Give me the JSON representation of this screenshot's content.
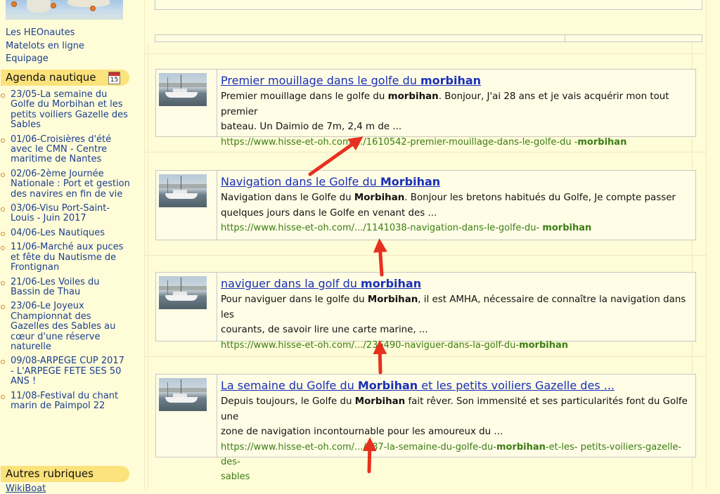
{
  "sidebar": {
    "links": [
      "Les HEOnautes",
      "Matelots en ligne",
      "Equipage"
    ],
    "agenda_title": "Agenda nautique",
    "calendar_day": "15",
    "agenda_items": [
      "23/05-La semaine du Golfe du Morbihan et les petits voiliers Gazelle des Sables",
      "01/06-Croisières d'été avec le CMN - Centre maritime de Nantes",
      "02/06-2ème Journée Nationale : Port et gestion des navires en fin de vie",
      "03/06-Visu Port-Saint-Louis - Juin 2017",
      "04/06-Les Nautiques",
      "11/06-Marché aux puces et fête du Nautisme de Frontignan",
      "21/06-Les Voiles du Bassin de Thau",
      "23/06-Le Joyeux Championnat des Gazelles des Sables au cœur d'une réserve naturelle",
      "09/08-ARPEGE CUP 2017 - L'ARPEGE FETE SES 50 ANS !",
      "11/08-Festival du chant marin de Paimpol 22"
    ],
    "autres_title": "Autres rubriques",
    "autres_first": "WikiBoat"
  },
  "results": [
    {
      "title_pre": "Premier mouillage dans le golfe du ",
      "title_bold": "morbihan",
      "title_post": "",
      "snippet_lines": [
        [
          {
            "t": "Premier mouillage dans le golfe du "
          },
          {
            "t": "morbihan",
            "b": true
          },
          {
            "t": ". Bonjour, J'ai 28 ans et je vais acquérir mon tout premier"
          }
        ],
        [
          {
            "t": "bateau. Un Daimio de 7m, 2,4 m de ..."
          }
        ]
      ],
      "url_lines": [
        [
          {
            "t": "https://www.hisse-et-oh.com/.../1610542-premier-mouillage-dans-le-golfe-du -"
          },
          {
            "t": "morbihan",
            "b": true
          }
        ]
      ]
    },
    {
      "title_pre": "Navigation dans le Golfe du ",
      "title_bold": "Morbihan",
      "title_post": "",
      "snippet_lines": [
        [
          {
            "t": "Navigation dans le Golfe du "
          },
          {
            "t": "Morbihan",
            "b": true
          },
          {
            "t": ". Bonjour les bretons habitués du Golfe, Je compte passer"
          }
        ],
        [
          {
            "t": "quelques jours dans le Golfe en venant des ..."
          }
        ]
      ],
      "url_lines": [
        [
          {
            "t": "https://www.hisse-et-oh.com/.../1141038-navigation-dans-le-golfe-du- "
          },
          {
            "t": "morbihan",
            "b": true
          }
        ]
      ]
    },
    {
      "title_pre": "naviguer dans la golf du ",
      "title_bold": "morbihan",
      "title_post": "",
      "snippet_lines": [
        [
          {
            "t": "Pour naviguer dans le golfe du "
          },
          {
            "t": "Morbihan",
            "b": true
          },
          {
            "t": ", il est AMHA, nécessaire de connaître la navigation dans les"
          }
        ],
        [
          {
            "t": "courants, de savoir lire une carte marine, ..."
          }
        ]
      ],
      "url_lines": [
        [
          {
            "t": "https://www.hisse-et-oh.com/.../236490-naviguer-dans-la-golf-du-"
          },
          {
            "t": "morbihan",
            "b": true
          }
        ]
      ]
    },
    {
      "title_pre": "La semaine du Golfe du ",
      "title_bold": "Morbihan",
      "title_post": " et les petits voiliers Gazelle des ...",
      "snippet_lines": [
        [
          {
            "t": "Depuis toujours, le Golfe du "
          },
          {
            "t": "Morbihan",
            "b": true
          },
          {
            "t": " fait rêver. Son immensité et ses particularités font du Golfe une"
          }
        ],
        [
          {
            "t": "zone de navigation incontournable pour les amoureux du ..."
          }
        ]
      ],
      "url_lines": [
        [
          {
            "t": "https://www.hisse-et-oh.com/.../387-la-semaine-du-golfe-du-"
          },
          {
            "t": "morbihan",
            "b": true
          },
          {
            "t": "-et-les- petits-voiliers-gazelle-des-"
          }
        ],
        [
          {
            "t": "sables"
          }
        ]
      ]
    }
  ],
  "colors": {
    "link_blue": "#1a2fb8",
    "url_green": "#3b7d14",
    "arrow_red": "#e8301e",
    "section_yellow": "#fbe27a"
  }
}
